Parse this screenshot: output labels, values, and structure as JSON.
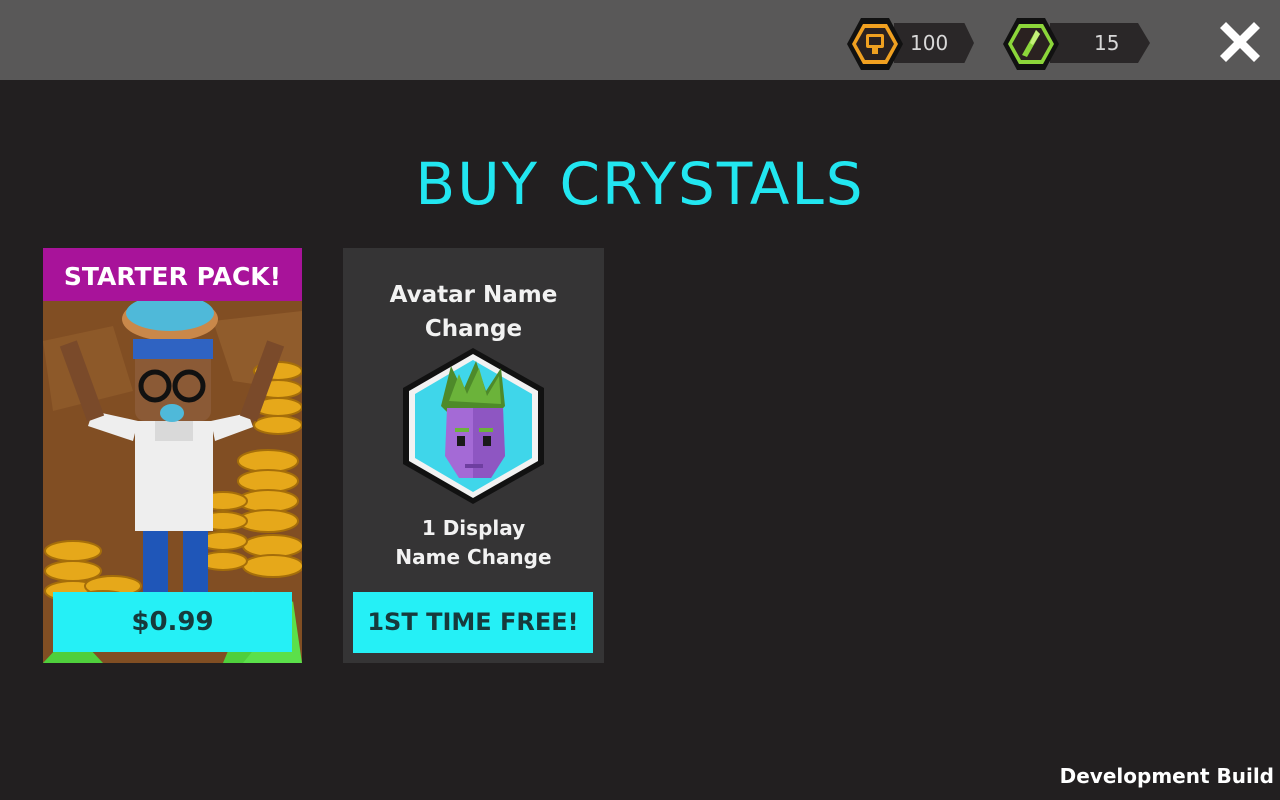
{
  "topbar": {
    "coins": {
      "value": "100",
      "icon": "coin-icon"
    },
    "crystals": {
      "value": "15",
      "icon": "crystal-icon"
    },
    "close_icon": "close-icon"
  },
  "title": "BUY CRYSTALS",
  "starter_pack": {
    "banner": "STARTER PACK!",
    "price": "$0.99"
  },
  "name_change": {
    "title_line1": "Avatar Name",
    "title_line2": "Change",
    "desc_line1": "1 Display",
    "desc_line2": "Name Change",
    "button": "1ST TIME FREE!"
  },
  "footer": {
    "build_label": "Development Build"
  },
  "colors": {
    "accent": "#22e6f0",
    "button": "#25f0f6",
    "banner": "#a8139a",
    "coin": "#f0a020",
    "crystal": "#8cd63a"
  }
}
